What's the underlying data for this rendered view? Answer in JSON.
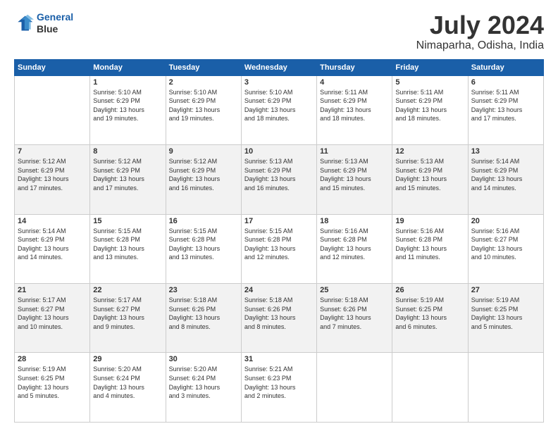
{
  "header": {
    "logo_line1": "General",
    "logo_line2": "Blue",
    "title": "July 2024",
    "subtitle": "Nimaparha, Odisha, India"
  },
  "days_of_week": [
    "Sunday",
    "Monday",
    "Tuesday",
    "Wednesday",
    "Thursday",
    "Friday",
    "Saturday"
  ],
  "weeks": [
    [
      {
        "day": "",
        "info": ""
      },
      {
        "day": "1",
        "info": "Sunrise: 5:10 AM\nSunset: 6:29 PM\nDaylight: 13 hours\nand 19 minutes."
      },
      {
        "day": "2",
        "info": "Sunrise: 5:10 AM\nSunset: 6:29 PM\nDaylight: 13 hours\nand 19 minutes."
      },
      {
        "day": "3",
        "info": "Sunrise: 5:10 AM\nSunset: 6:29 PM\nDaylight: 13 hours\nand 18 minutes."
      },
      {
        "day": "4",
        "info": "Sunrise: 5:11 AM\nSunset: 6:29 PM\nDaylight: 13 hours\nand 18 minutes."
      },
      {
        "day": "5",
        "info": "Sunrise: 5:11 AM\nSunset: 6:29 PM\nDaylight: 13 hours\nand 18 minutes."
      },
      {
        "day": "6",
        "info": "Sunrise: 5:11 AM\nSunset: 6:29 PM\nDaylight: 13 hours\nand 17 minutes."
      }
    ],
    [
      {
        "day": "7",
        "info": "Sunrise: 5:12 AM\nSunset: 6:29 PM\nDaylight: 13 hours\nand 17 minutes."
      },
      {
        "day": "8",
        "info": "Sunrise: 5:12 AM\nSunset: 6:29 PM\nDaylight: 13 hours\nand 17 minutes."
      },
      {
        "day": "9",
        "info": "Sunrise: 5:12 AM\nSunset: 6:29 PM\nDaylight: 13 hours\nand 16 minutes."
      },
      {
        "day": "10",
        "info": "Sunrise: 5:13 AM\nSunset: 6:29 PM\nDaylight: 13 hours\nand 16 minutes."
      },
      {
        "day": "11",
        "info": "Sunrise: 5:13 AM\nSunset: 6:29 PM\nDaylight: 13 hours\nand 15 minutes."
      },
      {
        "day": "12",
        "info": "Sunrise: 5:13 AM\nSunset: 6:29 PM\nDaylight: 13 hours\nand 15 minutes."
      },
      {
        "day": "13",
        "info": "Sunrise: 5:14 AM\nSunset: 6:29 PM\nDaylight: 13 hours\nand 14 minutes."
      }
    ],
    [
      {
        "day": "14",
        "info": "Sunrise: 5:14 AM\nSunset: 6:29 PM\nDaylight: 13 hours\nand 14 minutes."
      },
      {
        "day": "15",
        "info": "Sunrise: 5:15 AM\nSunset: 6:28 PM\nDaylight: 13 hours\nand 13 minutes."
      },
      {
        "day": "16",
        "info": "Sunrise: 5:15 AM\nSunset: 6:28 PM\nDaylight: 13 hours\nand 13 minutes."
      },
      {
        "day": "17",
        "info": "Sunrise: 5:15 AM\nSunset: 6:28 PM\nDaylight: 13 hours\nand 12 minutes."
      },
      {
        "day": "18",
        "info": "Sunrise: 5:16 AM\nSunset: 6:28 PM\nDaylight: 13 hours\nand 12 minutes."
      },
      {
        "day": "19",
        "info": "Sunrise: 5:16 AM\nSunset: 6:28 PM\nDaylight: 13 hours\nand 11 minutes."
      },
      {
        "day": "20",
        "info": "Sunrise: 5:16 AM\nSunset: 6:27 PM\nDaylight: 13 hours\nand 10 minutes."
      }
    ],
    [
      {
        "day": "21",
        "info": "Sunrise: 5:17 AM\nSunset: 6:27 PM\nDaylight: 13 hours\nand 10 minutes."
      },
      {
        "day": "22",
        "info": "Sunrise: 5:17 AM\nSunset: 6:27 PM\nDaylight: 13 hours\nand 9 minutes."
      },
      {
        "day": "23",
        "info": "Sunrise: 5:18 AM\nSunset: 6:26 PM\nDaylight: 13 hours\nand 8 minutes."
      },
      {
        "day": "24",
        "info": "Sunrise: 5:18 AM\nSunset: 6:26 PM\nDaylight: 13 hours\nand 8 minutes."
      },
      {
        "day": "25",
        "info": "Sunrise: 5:18 AM\nSunset: 6:26 PM\nDaylight: 13 hours\nand 7 minutes."
      },
      {
        "day": "26",
        "info": "Sunrise: 5:19 AM\nSunset: 6:25 PM\nDaylight: 13 hours\nand 6 minutes."
      },
      {
        "day": "27",
        "info": "Sunrise: 5:19 AM\nSunset: 6:25 PM\nDaylight: 13 hours\nand 5 minutes."
      }
    ],
    [
      {
        "day": "28",
        "info": "Sunrise: 5:19 AM\nSunset: 6:25 PM\nDaylight: 13 hours\nand 5 minutes."
      },
      {
        "day": "29",
        "info": "Sunrise: 5:20 AM\nSunset: 6:24 PM\nDaylight: 13 hours\nand 4 minutes."
      },
      {
        "day": "30",
        "info": "Sunrise: 5:20 AM\nSunset: 6:24 PM\nDaylight: 13 hours\nand 3 minutes."
      },
      {
        "day": "31",
        "info": "Sunrise: 5:21 AM\nSunset: 6:23 PM\nDaylight: 13 hours\nand 2 minutes."
      },
      {
        "day": "",
        "info": ""
      },
      {
        "day": "",
        "info": ""
      },
      {
        "day": "",
        "info": ""
      }
    ]
  ]
}
